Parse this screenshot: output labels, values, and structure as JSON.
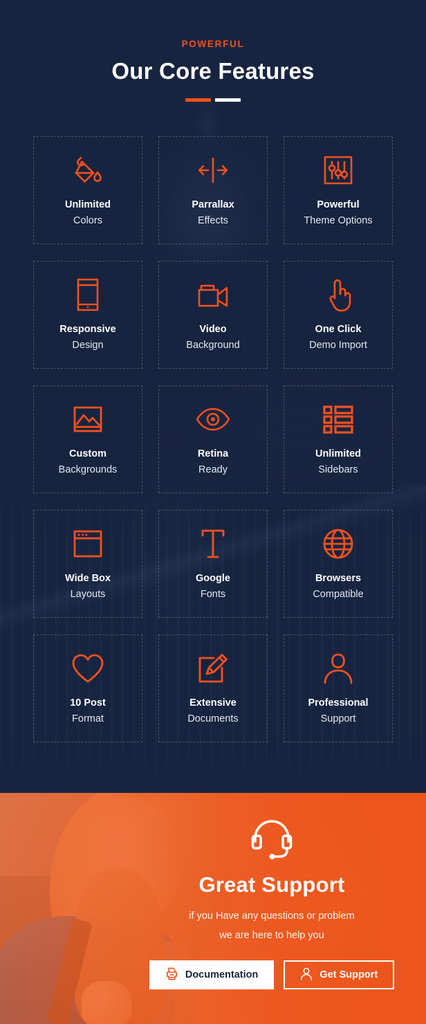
{
  "features": {
    "eyebrow": "POWERFUL",
    "title": "Our Core Features",
    "accent_color": "#F4511E",
    "background_color": "#17243F",
    "items": [
      {
        "icon": "paint-bucket-icon",
        "line1": "Unlimited",
        "line2": "Colors"
      },
      {
        "icon": "parallax-arrows-icon",
        "line1": "Parrallax",
        "line2": "Effects"
      },
      {
        "icon": "sliders-icon",
        "line1": "Powerful",
        "line2": "Theme Options"
      },
      {
        "icon": "mobile-phone-icon",
        "line1": "Responsive",
        "line2": "Design"
      },
      {
        "icon": "video-camera-icon",
        "line1": "Video",
        "line2": "Background"
      },
      {
        "icon": "pointing-hand-icon",
        "line1": "One Click",
        "line2": "Demo Import"
      },
      {
        "icon": "image-picture-icon",
        "line1": "Custom",
        "line2": "Backgrounds"
      },
      {
        "icon": "eye-icon",
        "line1": "Retina",
        "line2": "Ready"
      },
      {
        "icon": "list-layout-icon",
        "line1": "Unlimited",
        "line2": "Sidebars"
      },
      {
        "icon": "browser-window-icon",
        "line1": "Wide Box",
        "line2": "Layouts"
      },
      {
        "icon": "text-type-icon",
        "line1": "Google",
        "line2": "Fonts"
      },
      {
        "icon": "globe-icon",
        "line1": "Browsers",
        "line2": "Compatible"
      },
      {
        "icon": "heart-icon",
        "line1": "10 Post",
        "line2": "Format"
      },
      {
        "icon": "edit-document-icon",
        "line1": "Extensive",
        "line2": "Documents"
      },
      {
        "icon": "person-icon",
        "line1": "Professional",
        "line2": "Support"
      }
    ]
  },
  "support": {
    "icon": "headset-icon",
    "title": "Great Support",
    "subtitle_line1": "if you Have any questions or problem",
    "subtitle_line2": "we are here to help you",
    "background_color": "#EC541A",
    "buttons": [
      {
        "icon": "printer-icon",
        "label": "Documentation",
        "style": "solid-white"
      },
      {
        "icon": "user-icon",
        "label": "Get Support",
        "style": "outline-white"
      }
    ]
  }
}
